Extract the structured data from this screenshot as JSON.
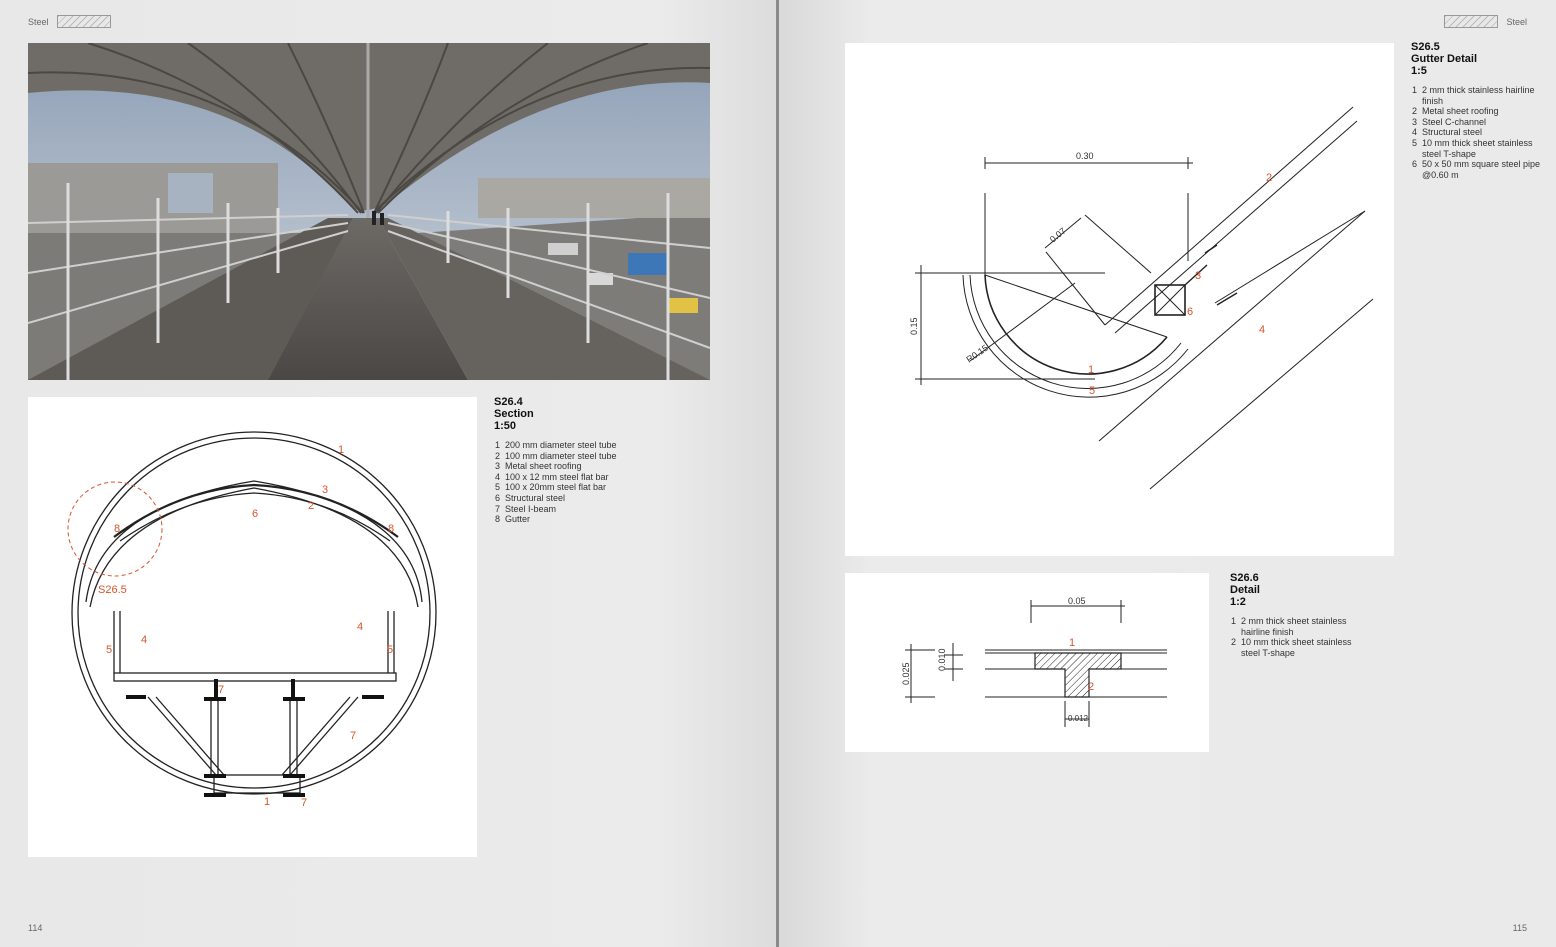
{
  "running_head": {
    "left": "Steel",
    "right": "Steel"
  },
  "folios": {
    "left": "114",
    "right": "115"
  },
  "photo": {
    "description": "covered steel skywalk"
  },
  "s264": {
    "ref": "S26.4",
    "name": "Section",
    "scale": "1:50",
    "items": [
      {
        "n": "1",
        "t": "200 mm diameter steel tube"
      },
      {
        "n": "2",
        "t": "100 mm diameter steel tube"
      },
      {
        "n": "3",
        "t": "Metal sheet roofing"
      },
      {
        "n": "4",
        "t": "100 x 12 mm steel flat bar"
      },
      {
        "n": "5",
        "t": "100 x 20mm steel flat bar"
      },
      {
        "n": "6",
        "t": "Structural steel"
      },
      {
        "n": "7",
        "t": "Steel I-beam"
      },
      {
        "n": "8",
        "t": "Gutter"
      }
    ],
    "callout": "S26.5"
  },
  "s265": {
    "ref": "S26.5",
    "name": "Gutter Detail",
    "scale": "1:5",
    "items": [
      {
        "n": "1",
        "t": "2 mm thick stainless hairline finish"
      },
      {
        "n": "2",
        "t": "Metal sheet roofing"
      },
      {
        "n": "3",
        "t": "Steel C-channel"
      },
      {
        "n": "4",
        "t": "Structural steel"
      },
      {
        "n": "5",
        "t": "10 mm thick sheet stainless steel T-shape"
      },
      {
        "n": "6",
        "t": "50 x 50 mm square steel pipe @0.60 m"
      }
    ],
    "dims": {
      "w": "0.30",
      "h": "0.15",
      "d": "0.07",
      "r": "R0.15"
    }
  },
  "s266": {
    "ref": "S26.6",
    "name": "Detail",
    "scale": "1:2",
    "items": [
      {
        "n": "1",
        "t": "2 mm thick sheet stainless hairline finish"
      },
      {
        "n": "2",
        "t": "10 mm thick sheet stainless steel T-shape"
      }
    ],
    "dims": {
      "w": "0.05",
      "h1": "0.025",
      "h2": "0.010",
      "b": "0.012"
    }
  },
  "colors": {
    "accent": "#d9532c",
    "line": "#222222",
    "panel": "#ffffff"
  }
}
